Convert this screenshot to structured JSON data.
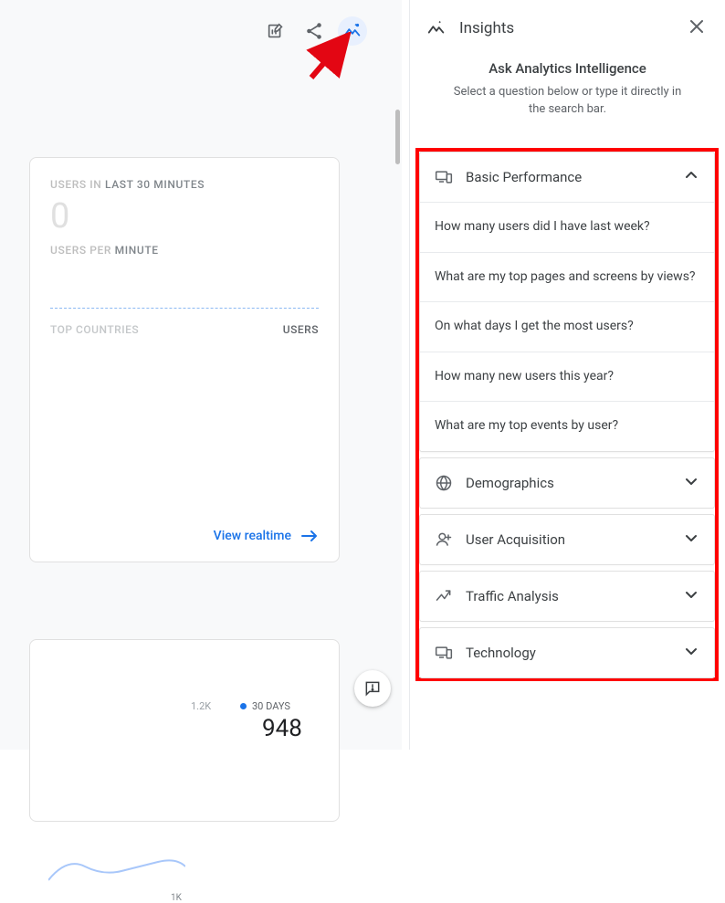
{
  "toolbar": {
    "customize": "Customize",
    "share": "Share",
    "insights": "Insights"
  },
  "realtime": {
    "label_last30_pre": "USERS IN ",
    "label_last30_post": "LAST 30 MINUTES",
    "zero": "0",
    "label_per_min_pre": "USERS PER",
    "label_per_min_post": " MINUTE",
    "col_countries": "TOP COUNTRIES",
    "col_users": "USERS",
    "view_link": "View realtime"
  },
  "chart": {
    "max_tick": "1.2K",
    "legend": "30 DAYS",
    "value": "948",
    "x_tick": "1K"
  },
  "panel": {
    "title": "Insights",
    "heading": "Ask Analytics Intelligence",
    "sub": "Select a question below or type it directly in the search bar."
  },
  "categories": [
    {
      "id": "basic-performance",
      "title": "Basic Performance",
      "expanded": true,
      "questions": [
        "How many users did I have last week?",
        "What are my top pages and screens by views?",
        "On what days I get the most users?",
        "How many new users this year?",
        "What are my top events by user?"
      ]
    },
    {
      "id": "demographics",
      "title": "Demographics",
      "expanded": false,
      "questions": []
    },
    {
      "id": "user-acquisition",
      "title": "User Acquisition",
      "expanded": false,
      "questions": []
    },
    {
      "id": "traffic-analysis",
      "title": "Traffic Analysis",
      "expanded": false,
      "questions": []
    },
    {
      "id": "technology",
      "title": "Technology",
      "expanded": false,
      "questions": []
    }
  ]
}
